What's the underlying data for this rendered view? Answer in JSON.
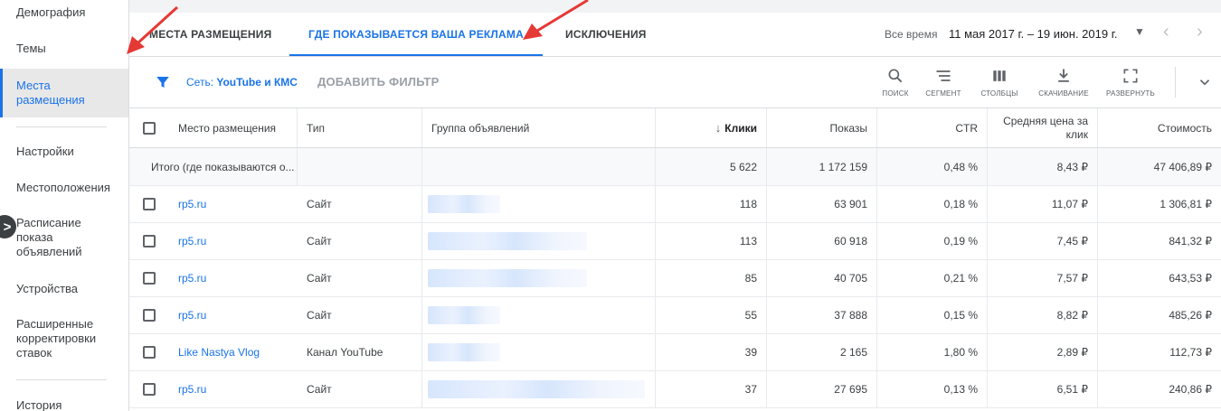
{
  "sidebar": {
    "items": [
      {
        "label": "Демография"
      },
      {
        "label": "Темы"
      },
      {
        "label": "Места размещения"
      },
      {
        "label": "Настройки"
      },
      {
        "label": "Местоположения"
      },
      {
        "label": "Расписание показа объявлений"
      },
      {
        "label": "Устройства"
      },
      {
        "label": "Расширенные корректировки ставок"
      },
      {
        "label": "История"
      }
    ],
    "collapse_glyph": ">"
  },
  "tabs": [
    {
      "label": "МЕСТА РАЗМЕЩЕНИЯ"
    },
    {
      "label": "ГДЕ ПОКАЗЫВАЕТСЯ ВАША РЕКЛАМА"
    },
    {
      "label": "ИСКЛЮЧЕНИЯ"
    }
  ],
  "date_range": {
    "label": "Все время",
    "value": "11 мая 2017 г. – 19 июн. 2019 г.",
    "caret": "▼",
    "prev": "‹",
    "next": "›"
  },
  "toolbar": {
    "filter_network_label": "Сеть: ",
    "filter_network_value": "YouTube и КМС",
    "add_filter": "ДОБАВИТЬ ФИЛЬТР",
    "tools": [
      {
        "label": "ПОИСК",
        "icon": "search-icon"
      },
      {
        "label": "СЕГМЕНТ",
        "icon": "segment-icon"
      },
      {
        "label": "СТОЛБЦЫ",
        "icon": "columns-icon"
      },
      {
        "label": "СКАЧИВАНИЕ",
        "icon": "download-icon"
      },
      {
        "label": "РАЗВЕРНУТЬ",
        "icon": "fullscreen-icon"
      }
    ]
  },
  "table": {
    "headers": {
      "placement": "Место размещения",
      "type": "Тип",
      "ad_group": "Группа объявлений",
      "clicks": "Клики",
      "impressions": "Показы",
      "ctr": "CTR",
      "avg_cpc": "Средняя цена за клик",
      "cost": "Стоимость",
      "sort_glyph": "↓"
    },
    "total": {
      "label": "Итого (где показываются о...",
      "clicks": "5 622",
      "impressions": "1 172 159",
      "ctr": "0,48 %",
      "avg_cpc": "8,43 ₽",
      "cost": "47 406,89 ₽"
    },
    "rows": [
      {
        "placement": "rp5.ru",
        "type": "Сайт",
        "clicks": "118",
        "impressions": "63 901",
        "ctr": "0,18 %",
        "avg_cpc": "11,07 ₽",
        "cost": "1 306,81 ₽"
      },
      {
        "placement": "rp5.ru",
        "type": "Сайт",
        "clicks": "113",
        "impressions": "60 918",
        "ctr": "0,19 %",
        "avg_cpc": "7,45 ₽",
        "cost": "841,32 ₽"
      },
      {
        "placement": "rp5.ru",
        "type": "Сайт",
        "clicks": "85",
        "impressions": "40 705",
        "ctr": "0,21 %",
        "avg_cpc": "7,57 ₽",
        "cost": "643,53 ₽"
      },
      {
        "placement": "rp5.ru",
        "type": "Сайт",
        "clicks": "55",
        "impressions": "37 888",
        "ctr": "0,15 %",
        "avg_cpc": "8,82 ₽",
        "cost": "485,26 ₽"
      },
      {
        "placement": "Like Nastya Vlog",
        "type": "Канал YouTube",
        "clicks": "39",
        "impressions": "2 165",
        "ctr": "1,80 %",
        "avg_cpc": "2,89 ₽",
        "cost": "112,73 ₽"
      },
      {
        "placement": "rp5.ru",
        "type": "Сайт",
        "clicks": "37",
        "impressions": "27 695",
        "ctr": "0,13 %",
        "avg_cpc": "6,51 ₽",
        "cost": "240,86 ₽"
      }
    ]
  },
  "colors": {
    "accent": "#1a73e8",
    "annotation_arrow": "#e53935"
  }
}
